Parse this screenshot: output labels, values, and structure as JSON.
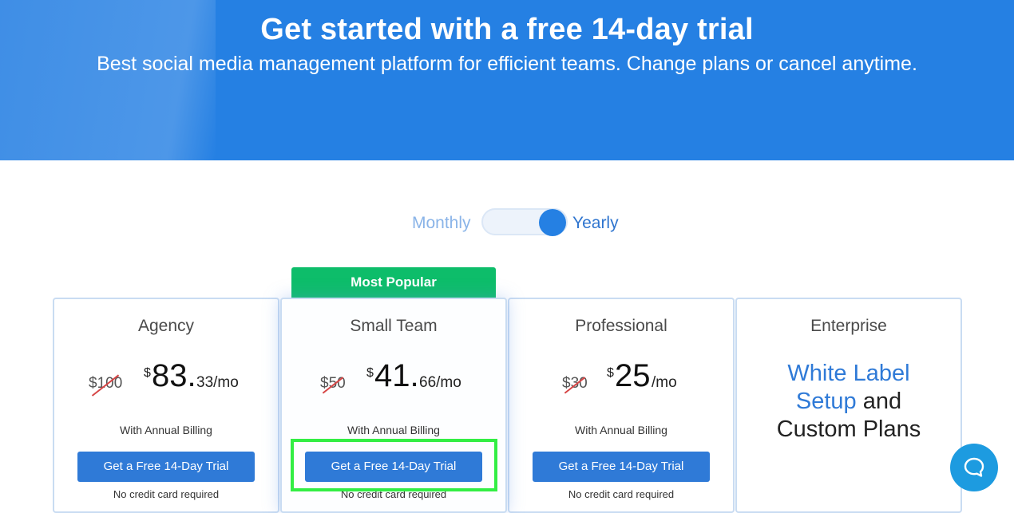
{
  "hero": {
    "title": "Get started with a free 14-day trial",
    "subtitle": "Best social media management platform for efficient teams. Change plans or cancel anytime."
  },
  "billing_toggle": {
    "monthly_label": "Monthly",
    "yearly_label": "Yearly",
    "selected": "Yearly"
  },
  "badge": {
    "label": "Most Popular"
  },
  "plans": [
    {
      "name": "Agency",
      "old_price": "$100",
      "currency": "$",
      "price_whole": "83.",
      "price_cents": "33/mo",
      "billing_note": "With Annual Billing",
      "cta": "Get a Free 14-Day Trial",
      "cta_note": "No credit card required"
    },
    {
      "name": "Small Team",
      "old_price": "$50",
      "currency": "$",
      "price_whole": "41.",
      "price_cents": "66/mo",
      "billing_note": "With Annual Billing",
      "cta": "Get a Free 14-Day Trial",
      "cta_note": "No credit card required"
    },
    {
      "name": "Professional",
      "old_price": "$30",
      "currency": "$",
      "price_whole": "25",
      "price_cents": "/mo",
      "billing_note": "With Annual Billing",
      "cta": "Get a Free 14-Day Trial",
      "cta_note": "No credit card required"
    },
    {
      "name": "Enterprise",
      "line1": "White Label",
      "line2_blue": "Setup",
      "line2_rest": " and",
      "line3": "Custom Plans"
    }
  ],
  "colors": {
    "hero_bg": "#2580e3",
    "accent": "#2f7ad7",
    "badge": "#0dbd6a",
    "highlight": "#33ee44",
    "strike": "#d64545"
  },
  "icons": {
    "chat": "chat-bubble-icon"
  }
}
